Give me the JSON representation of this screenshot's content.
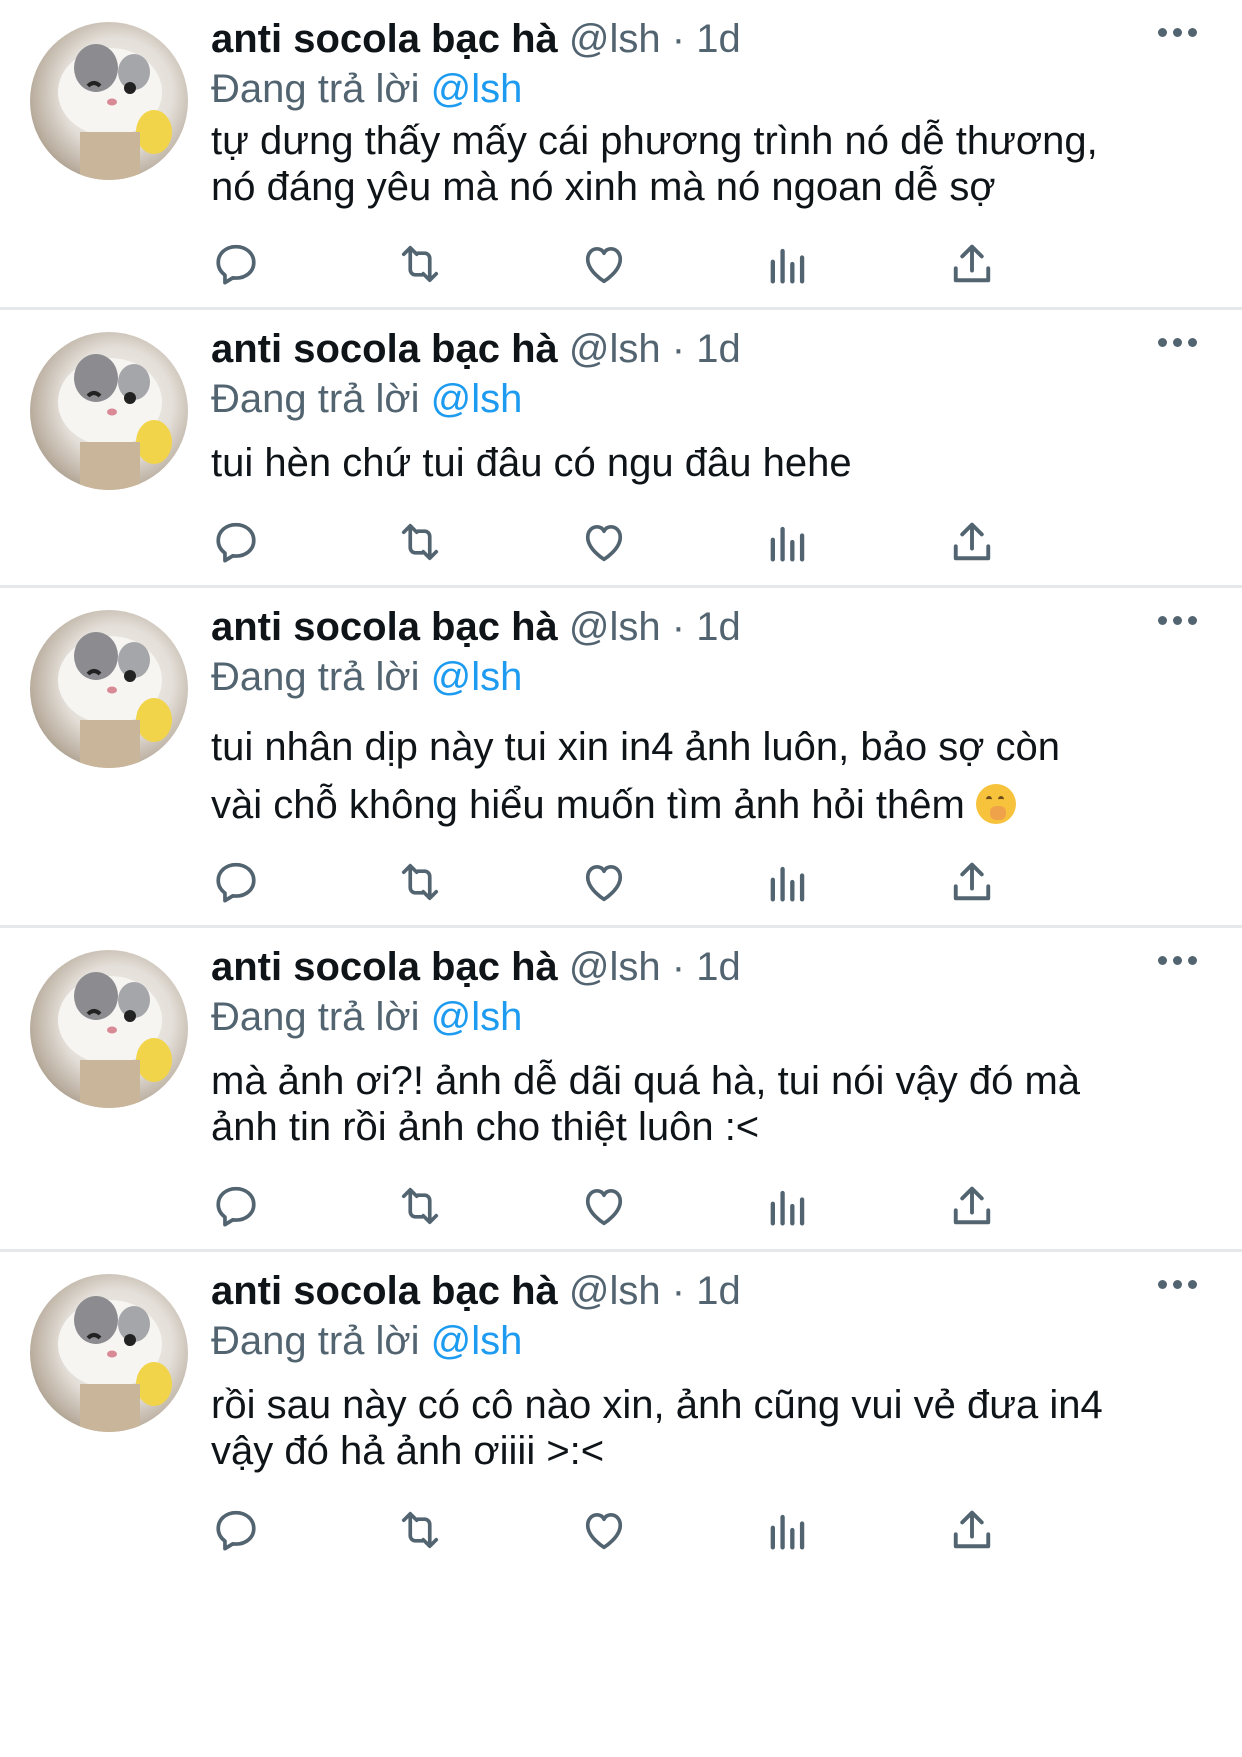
{
  "tweets": [
    {
      "name": "anti socola bạc hà",
      "handle": "@lsh",
      "sep": " · ",
      "time": "1d",
      "reply_prefix": "Đang trả lời ",
      "reply_to": "@lsh",
      "lines": [
        "tự dưng thấy mấy cái phương trình nó dễ thương,",
        "nó đáng yêu mà nó xinh mà nó ngoan dễ sợ"
      ]
    },
    {
      "name": "anti socola bạc hà",
      "handle": "@lsh",
      "sep": " · ",
      "time": "1d",
      "reply_prefix": "Đang trả lời ",
      "reply_to": "@lsh",
      "lines": [
        "tui hèn chứ tui đâu có ngu đâu hehe"
      ]
    },
    {
      "name": "anti socola bạc hà",
      "handle": "@lsh",
      "sep": " · ",
      "time": "1d",
      "reply_prefix": "Đang trả lời ",
      "reply_to": "@lsh",
      "lines": [
        "tui nhân dịp này tui xin in4 ảnh luôn, bảo sợ còn",
        "vài chỗ không hiểu muốn tìm ảnh hỏi thêm "
      ],
      "emoji": "hand-over-mouth"
    },
    {
      "name": "anti socola bạc hà",
      "handle": "@lsh",
      "sep": " · ",
      "time": "1d",
      "reply_prefix": "Đang trả lời ",
      "reply_to": "@lsh",
      "lines": [
        "mà ảnh ơi?! ảnh dễ dãi quá hà, tui nói vậy đó mà",
        "ảnh tin rồi ảnh cho thiệt luôn :<"
      ]
    },
    {
      "name": "anti socola bạc hà",
      "handle": "@lsh",
      "sep": " · ",
      "time": "1d",
      "reply_prefix": "Đang trả lời ",
      "reply_to": "@lsh",
      "lines": [
        "rồi sau này có cô nào xin, ảnh cũng vui vẻ đưa in4",
        "vậy đó hả ảnh ơiiii >:<"
      ]
    }
  ],
  "icons": {
    "more": "more-horizontal-icon",
    "reply": "reply-icon",
    "retweet": "retweet-icon",
    "like": "heart-icon",
    "views": "views-chart-icon",
    "share": "share-icon"
  },
  "colors": {
    "text": "#0f1419",
    "secondary": "#536471",
    "link": "#1d9bf0",
    "divider": "#e6e9ec"
  }
}
